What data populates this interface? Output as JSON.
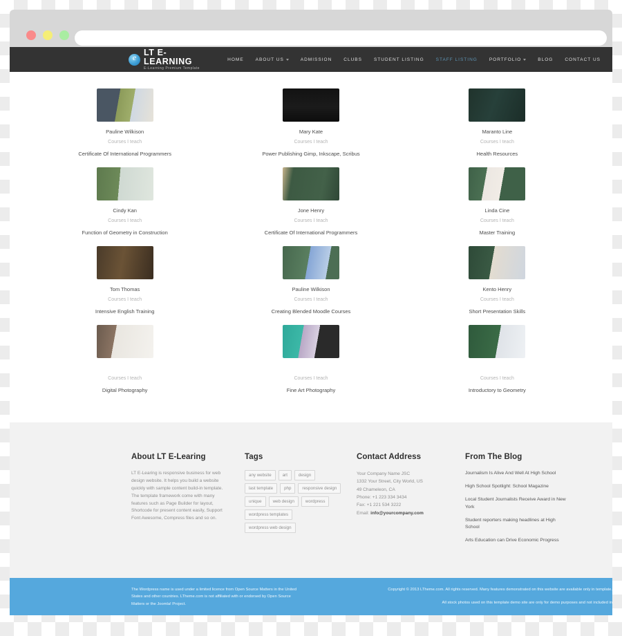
{
  "browser": {
    "url_value": "",
    "url_placeholder": "",
    "traffic_lights": [
      "close-red",
      "minimize-yellow",
      "maximize-green"
    ]
  },
  "header": {
    "logo_title": "LT E-LEARNING",
    "logo_subtitle": "E-Learning Premium Template",
    "logo_icon": "circle-e-logo-icon",
    "nav": [
      {
        "label": "HOME",
        "active": false,
        "caret": false
      },
      {
        "label": "ABOUT US",
        "active": false,
        "caret": true
      },
      {
        "label": "ADMISSION",
        "active": false,
        "caret": false
      },
      {
        "label": "CLUBS",
        "active": false,
        "caret": false
      },
      {
        "label": "STUDENT LISTING",
        "active": false,
        "caret": false
      },
      {
        "label": "STAFF LISTING",
        "active": true,
        "caret": false
      },
      {
        "label": "PORTFOLIO",
        "active": false,
        "caret": true
      },
      {
        "label": "BLOG",
        "active": false,
        "caret": false
      },
      {
        "label": "CONTACT US",
        "active": false,
        "caret": false
      }
    ],
    "active_color": "#5e94b4",
    "bar_color": "#333333"
  },
  "staff": [
    {
      "name": "Pauline Wilkison",
      "subtitle": "Courses I teach",
      "course": "Certificate Of International Programmers"
    },
    {
      "name": "Mary Kate",
      "subtitle": "Courses I teach",
      "course": "Power Publishing Gimp, Inkscape, Scribus"
    },
    {
      "name": "Maranto Line",
      "subtitle": "Courses I teach",
      "course": "Health Resources"
    },
    {
      "name": "Cindy Kan",
      "subtitle": "Courses I teach",
      "course": "Function of Geometry in Construction"
    },
    {
      "name": "Jone Henry",
      "subtitle": "Courses I teach",
      "course": "Certificate Of International Programmers"
    },
    {
      "name": "Linda Cine",
      "subtitle": "Courses I teach",
      "course": "Master Training"
    },
    {
      "name": "Tom Thomas",
      "subtitle": "Courses I teach",
      "course": "Intensive English Training"
    },
    {
      "name": "Pauline Wilkison",
      "subtitle": "Courses I teach",
      "course": "Creating Blended Moodle Courses"
    },
    {
      "name": "Kento Henry",
      "subtitle": "Courses I teach",
      "course": "Short Presentation Skills"
    },
    {
      "name": "",
      "subtitle": "Courses I teach",
      "course": "Digital Photography"
    },
    {
      "name": "",
      "subtitle": "Courses I teach",
      "course": "Fine Art Photography"
    },
    {
      "name": "",
      "subtitle": "Courses I teach",
      "course": "Introductory to Geometry"
    }
  ],
  "footer": {
    "about": {
      "title": "About LT E-Learing",
      "text": "LT E-Learing is responsive business for web design website. It helps you build a website quickly with sample content build-in template. The template framework come with many features such as Page Builder for layout, Shortcode for present content easily, Support Font Awesome, Compress files and so on."
    },
    "tags": {
      "title": "Tags",
      "items": [
        "any website",
        "art",
        "design",
        "last template",
        "php",
        "responsive design",
        "unique",
        "web design",
        "wordpress",
        "wordpress templates",
        "wordpress web design"
      ]
    },
    "contact": {
      "title": "Contact Address",
      "company": "Your Company Name JSC",
      "street": "1332 Your Street, City World, US",
      "city": "49 Chameleon, CA",
      "phone": "Phone: +1 223 334 3434",
      "fax": "Fax: +1 221 534 3222",
      "email_label": "Email: ",
      "email": "info@yourcompany.com"
    },
    "blog": {
      "title": "From The Blog",
      "posts": [
        "Journalism Is Alive And Well At High School",
        "High School Spotlight: School Magazine",
        "Local Student Journalists Receive Award in New York",
        "Student reporters making headlines at High School",
        "Arts Education can Drive Economic Progress"
      ]
    },
    "bottom": {
      "bar_color": "#55a8dd",
      "left_text": "The Wordpress name is used under a limited licence from Open Source Matters in the United States and other countries. LTheme.com is not affiliated with or endorsed by Open Source Matters or the Joomla! Project.",
      "right_text_1": "Copyright © 2013 LTheme.com. All rights reserved. Many features demonstrated on this website are available only in template.",
      "right_text_2": "All stock photos used on this template demo site are only for demo purposes and not included in"
    }
  }
}
